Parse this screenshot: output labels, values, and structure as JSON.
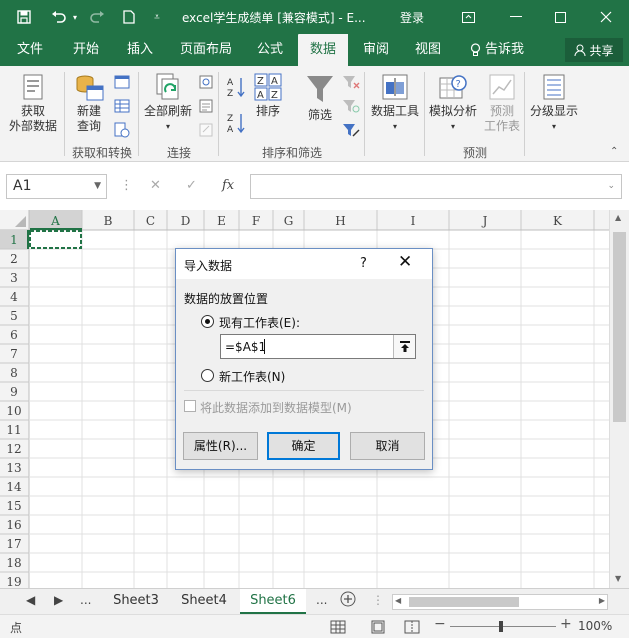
{
  "window": {
    "title": "excel学生成绩单 [兼容模式] - E...",
    "login_label": "登录"
  },
  "tabs": [
    {
      "label": "文件",
      "active": false
    },
    {
      "label": "开始",
      "active": false
    },
    {
      "label": "插入",
      "active": false
    },
    {
      "label": "页面布局",
      "active": false
    },
    {
      "label": "公式",
      "active": false
    },
    {
      "label": "数据",
      "active": true
    },
    {
      "label": "审阅",
      "active": false
    },
    {
      "label": "视图",
      "active": false
    },
    {
      "label": "告诉我",
      "active": false
    }
  ],
  "share_label": "共享",
  "ribbon": {
    "get_external_line1": "获取",
    "get_external_line2": "外部数据",
    "new_query_line1": "新建",
    "new_query_line2": "查询",
    "refresh_all": "全部刷新",
    "sort": "排序",
    "filter": "筛选",
    "data_tools": "数据工具",
    "what_if": "模拟分析",
    "forecast_line1": "预测",
    "forecast_line2": "工作表",
    "outline": "分级显示",
    "groups": {
      "get_transform": "获取和转换",
      "connections": "连接",
      "sort_filter": "排序和筛选",
      "forecast": "预测"
    }
  },
  "formula_bar": {
    "name_box": "A1",
    "fx": "fx",
    "value": ""
  },
  "grid": {
    "columns": [
      "A",
      "B",
      "C",
      "D",
      "E",
      "F",
      "G",
      "H",
      "I",
      "J",
      "K"
    ],
    "rows": [
      "1",
      "2",
      "3",
      "4",
      "5",
      "6",
      "7",
      "8",
      "9",
      "10",
      "11",
      "12",
      "13",
      "14",
      "15",
      "16",
      "17",
      "18",
      "19"
    ],
    "selected_cell": "A1"
  },
  "sheets": {
    "ellipsis": "...",
    "tabs": [
      {
        "label": "Sheet3",
        "active": false
      },
      {
        "label": "Sheet4",
        "active": false
      },
      {
        "label": "Sheet6",
        "active": true
      }
    ]
  },
  "status": {
    "mode": "点",
    "zoom": "100%"
  },
  "dialog": {
    "title": "导入数据",
    "help": "?",
    "section_label": "数据的放置位置",
    "existing_sheet_label": "现有工作表(E):",
    "existing_sheet_selected": true,
    "reference_value": "=$A$1",
    "new_sheet_label": "新工作表(N)",
    "add_model_label": "将此数据添加到数据模型(M)",
    "add_model_enabled": false,
    "properties_button": "属性(R)...",
    "ok_button": "确定",
    "cancel_button": "取消"
  },
  "colors": {
    "brand": "#217346",
    "dialog_border": "#6a8fc4",
    "default_button_border": "#0078d7"
  }
}
